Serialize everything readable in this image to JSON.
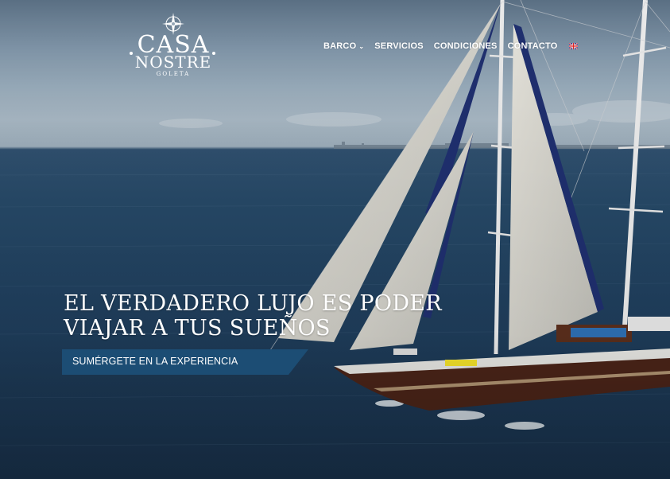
{
  "brand": {
    "line1": "CASA",
    "line2": "NOSTRE",
    "line3": "GOLETA"
  },
  "nav": {
    "items": [
      {
        "label": "BARCO",
        "has_dropdown": true
      },
      {
        "label": "SERVICIOS"
      },
      {
        "label": "CONDICIONES"
      },
      {
        "label": "CONTACTO"
      }
    ],
    "language_flag": "uk-flag-icon"
  },
  "hero": {
    "headline_line1": "EL VERDADERO LUJO ES PODER",
    "headline_line2": "VIAJAR A TUS SUEÑOS",
    "cta_label": "SUMÉRGETE EN LA EXPERIENCIA",
    "cta_color": "#1c4d74"
  }
}
